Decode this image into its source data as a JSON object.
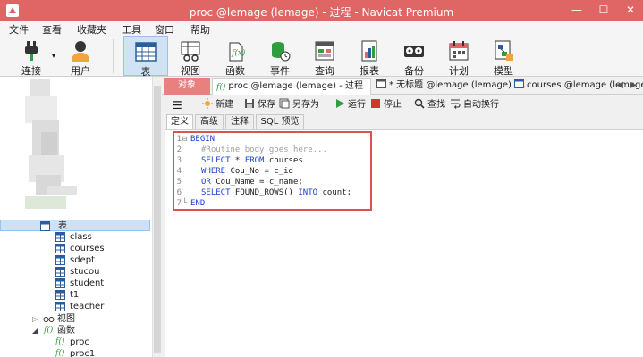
{
  "window": {
    "title": "proc @lemage (lemage) - 过程 - Navicat Premium",
    "minimize": "—",
    "maximize": "☐",
    "close": "✕"
  },
  "menu": [
    "文件",
    "查看",
    "收藏夹",
    "工具",
    "窗口",
    "帮助"
  ],
  "toolbar": {
    "connect": "连接",
    "user": "用户",
    "table": "表",
    "view": "视图",
    "function": "函数",
    "event": "事件",
    "query": "查询",
    "report": "报表",
    "backup": "备份",
    "schedule": "计划",
    "model": "模型"
  },
  "tree": {
    "tables_label": "表",
    "tables": [
      "class",
      "courses",
      "sdept",
      "stucou",
      "student",
      "t1",
      "teacher"
    ],
    "views_label": "视图",
    "functions_label": "函数",
    "functions": [
      "proc",
      "proc1"
    ]
  },
  "tabs": {
    "objects": "对象",
    "active": "proc @lemage (lemage) - 过程",
    "other1": "* 无标题 @lemage (lemage) - ...",
    "other2": "courses @lemage (lemage) - 表"
  },
  "subtabs": [
    "定义",
    "高级",
    "注释",
    "SQL 预览"
  ],
  "editor_toolbar": {
    "menu": "☰",
    "new": "新建",
    "save": "保存",
    "save_as": "另存为",
    "run": "运行",
    "stop": "停止",
    "find": "查找",
    "word_wrap": "自动换行"
  },
  "code": {
    "line_numbers": [
      "1",
      "2",
      "3",
      "4",
      "5",
      "6",
      "7"
    ],
    "l1": "BEGIN",
    "l2": "#Routine body goes here...",
    "l3a": "SELECT",
    "l3b": " * ",
    "l3c": "FROM",
    "l3d": " courses",
    "l4a": "WHERE",
    "l4b": " Cou_No = c_id",
    "l5a": "OR",
    "l5b": " Cou_Name = c_name;",
    "l6a": "SELECT",
    "l6b": " FOUND_ROWS() ",
    "l6c": "INTO",
    "l6d": " count;",
    "l7": "END"
  },
  "colors": {
    "accent": "#e06666",
    "keyword": "#1a3fd1",
    "highlight_box": "#d9534f"
  }
}
